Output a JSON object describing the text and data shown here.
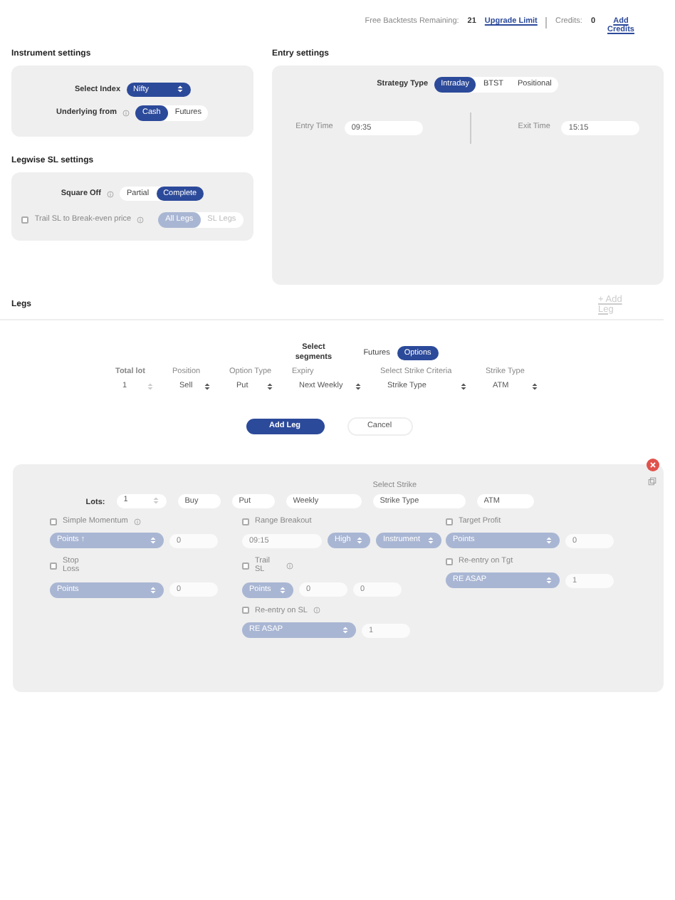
{
  "header": {
    "backtests_label": "Free Backtests Remaining:",
    "backtests_count": "21",
    "upgrade_link": "Upgrade Limit",
    "credits_label": "Credits:",
    "credits_count": "0",
    "add_credits": "Add Credits"
  },
  "instrument_settings": {
    "title": "Instrument settings",
    "select_index": {
      "label": "Select Index",
      "value": "Nifty"
    },
    "underlying_from": {
      "label": "Underlying from",
      "info": true,
      "options": [
        {
          "label": "Cash",
          "selected": true
        },
        {
          "label": "Futures",
          "selected": false
        }
      ]
    }
  },
  "legwise_sl_settings": {
    "title": "Legwise SL settings",
    "square_off": {
      "label": "Square Off",
      "info": true,
      "options": [
        {
          "label": "Partial",
          "selected": false
        },
        {
          "label": "Complete",
          "selected": true
        }
      ]
    },
    "trail_sl": {
      "label": "Trail SL to Break-even price",
      "info": true,
      "checked": false,
      "disabled": true,
      "options": [
        {
          "label": "All Legs",
          "selected": true
        },
        {
          "label": "SL Legs",
          "selected": false
        }
      ]
    }
  },
  "entry_settings": {
    "title": "Entry settings",
    "strategy_type": {
      "label": "Strategy Type",
      "options": [
        {
          "label": "Intraday",
          "selected": true
        },
        {
          "label": "BTST",
          "selected": false
        },
        {
          "label": "Positional",
          "selected": false
        }
      ]
    },
    "entry_time": {
      "label": "Entry Time",
      "value": "09:35"
    },
    "exit_time": {
      "label": "Exit Time",
      "value": "15:15"
    }
  },
  "legs": {
    "title": "Legs",
    "add_leg_link": "+ Add Leg",
    "segments": {
      "label": "Select segments",
      "options": [
        {
          "label": "Futures",
          "selected": false
        },
        {
          "label": "Options",
          "selected": true
        }
      ]
    },
    "fields": [
      {
        "label": "Total lot",
        "kind": "number",
        "value": "1"
      },
      {
        "label": "Position",
        "kind": "select",
        "value": "Sell"
      },
      {
        "label": "Option Type",
        "kind": "select",
        "value": "Put"
      },
      {
        "label": "Expiry",
        "kind": "select",
        "value": "Next Weekly"
      },
      {
        "label": "Select Strike Criteria",
        "kind": "select",
        "value": "Strike Type"
      },
      {
        "label": "Strike Type",
        "kind": "select",
        "value": "ATM"
      }
    ],
    "buttons": [
      {
        "label": "Add Leg",
        "kind": "primary"
      },
      {
        "label": "Cancel",
        "kind": "secondary"
      }
    ]
  },
  "leg_card": {
    "lots_label": "Lots:",
    "fields": [
      {
        "kind": "number",
        "value": "1"
      },
      {
        "kind": "text",
        "value": "Buy"
      },
      {
        "kind": "text",
        "value": "Put"
      },
      {
        "kind": "text",
        "value": "Weekly"
      },
      {
        "kind": "text",
        "value": "Strike Type",
        "label": "Select Strike"
      },
      {
        "kind": "text",
        "value": "ATM"
      }
    ],
    "options": [
      {
        "label": "Simple Momentum",
        "info": true,
        "checked": false,
        "controls": [
          {
            "kind": "select",
            "value": "Points ↑"
          },
          {
            "kind": "input",
            "value": "0"
          }
        ]
      },
      {
        "label": "Range Breakout",
        "info": false,
        "checked": false,
        "controls": [
          {
            "kind": "input",
            "value": "09:15"
          },
          {
            "kind": "select",
            "value": "High"
          },
          {
            "kind": "select",
            "value": "Instrument"
          }
        ]
      },
      {
        "label": "Target Profit",
        "info": false,
        "checked": false,
        "controls": [
          {
            "kind": "select",
            "value": "Points"
          },
          {
            "kind": "input",
            "value": "0"
          }
        ]
      },
      {
        "label": "Stop Loss",
        "info": false,
        "checked": false,
        "controls": [
          {
            "kind": "select",
            "value": "Points"
          },
          {
            "kind": "input",
            "value": "0"
          }
        ]
      },
      {
        "label": "Trail SL",
        "info": true,
        "checked": false,
        "controls": [
          {
            "kind": "select",
            "value": "Points"
          },
          {
            "kind": "input",
            "value": "0"
          },
          {
            "kind": "input",
            "value": "0"
          }
        ]
      },
      {
        "label": "Re-entry on Tgt",
        "info": false,
        "checked": false,
        "controls": [
          {
            "kind": "select",
            "value": "RE ASAP"
          },
          {
            "kind": "input",
            "value": "1"
          }
        ]
      },
      {
        "label": "Re-entry on SL",
        "info": true,
        "checked": false,
        "controls": [
          {
            "kind": "select",
            "value": "RE ASAP"
          },
          {
            "kind": "input",
            "value": "1"
          }
        ]
      }
    ]
  }
}
